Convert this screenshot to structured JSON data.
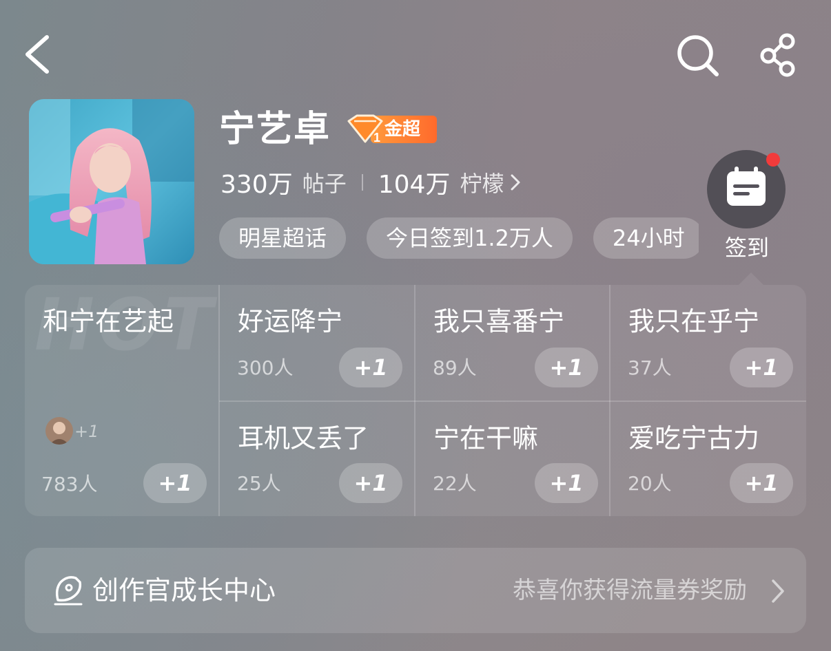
{
  "header": {
    "back_icon": "chevron-left-icon",
    "search_icon": "search-icon",
    "share_icon": "share-icon"
  },
  "topic": {
    "name": "宁艺卓",
    "badge_rank": "1",
    "badge_label": "金超",
    "posts_count": "330万",
    "posts_label": "帖子",
    "lemons_count": "104万",
    "lemons_label": "柠檬"
  },
  "tags": [
    {
      "label": "明星超话"
    },
    {
      "label": "今日签到1.2万人"
    },
    {
      "label": "24小时"
    }
  ],
  "checkin": {
    "label": "签到",
    "icon": "calendar-icon",
    "has_notification": true
  },
  "hot_board": {
    "watermark": "HOT",
    "featured": {
      "title": "和宁在艺起",
      "avatar_extra": "+1",
      "count": "783人",
      "plus_label": "+1"
    },
    "items": [
      {
        "title": "好运降宁",
        "count": "300人",
        "plus_label": "+1"
      },
      {
        "title": "我只喜番宁",
        "count": "89人",
        "plus_label": "+1"
      },
      {
        "title": "我只在乎宁",
        "count": "37人",
        "plus_label": "+1"
      },
      {
        "title": "耳机又丢了",
        "count": "25人",
        "plus_label": "+1"
      },
      {
        "title": "宁在干嘛",
        "count": "22人",
        "plus_label": "+1"
      },
      {
        "title": "爱吃宁古力",
        "count": "20人",
        "plus_label": "+1"
      }
    ]
  },
  "creator_center": {
    "title": "创作官成长中心",
    "reward_text": "恭喜你获得流量券奖励",
    "icon": "creator-pen-icon"
  },
  "colors": {
    "badge_orange": "#ff7a30",
    "notification_red": "#f23b3b"
  }
}
